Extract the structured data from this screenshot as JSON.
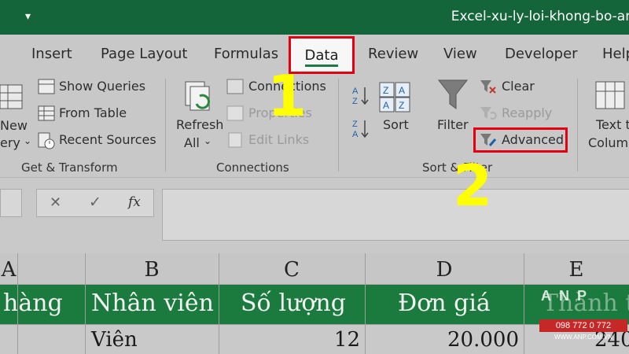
{
  "window": {
    "title": "Excel-xu-ly-loi-khong-bo-an"
  },
  "ribbon": {
    "tabs": [
      "Insert",
      "Page Layout",
      "Formulas",
      "Data",
      "Review",
      "View",
      "Developer",
      "Help"
    ],
    "active_tab": "Data",
    "get_transform": {
      "new_query_line1": "New",
      "new_query_line2": "ery",
      "show_queries": "Show Queries",
      "from_table": "From Table",
      "recent_sources": "Recent Sources",
      "label": "Get & Transform"
    },
    "connections": {
      "refresh_all_line1": "Refresh",
      "refresh_all_line2": "All",
      "connections": "Connections",
      "properties": "Properties",
      "edit_links": "Edit Links",
      "label": "Connections"
    },
    "sort_filter": {
      "sort": "Sort",
      "filter": "Filter",
      "clear": "Clear",
      "reapply": "Reapply",
      "advanced": "Advanced",
      "label": "Sort & Filter"
    },
    "data_tools": {
      "text_to_columns_line1": "Text to",
      "text_to_columns_line2": "Colum"
    }
  },
  "annotations": {
    "step1": "1",
    "step2": "2"
  },
  "formula_bar": {
    "fx": "fx"
  },
  "sheet": {
    "columns": [
      "A",
      "B",
      "C",
      "D",
      "E"
    ],
    "header_row": [
      "hàng",
      "Nhân viên",
      "Số lượng",
      "Đơn giá",
      "Thành t"
    ],
    "data_row": [
      "",
      "Viên",
      "12",
      "20.000",
      "240"
    ]
  },
  "watermark": {
    "letters": "ANP",
    "phone": "098 772 0 772",
    "site": "WWW.ANP.COM.VN"
  },
  "colors": {
    "excel_green": "#1b7a3d",
    "highlight_red": "#e3000f",
    "annotation_yellow": "#ffff00"
  }
}
